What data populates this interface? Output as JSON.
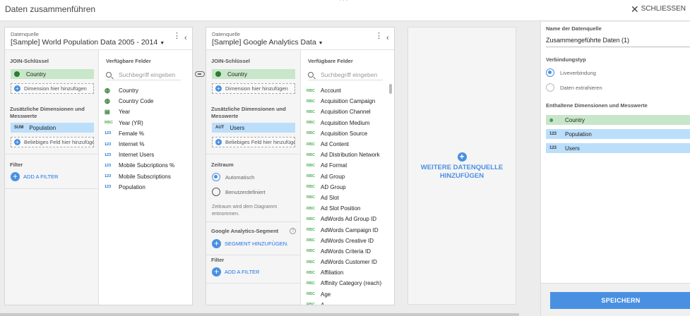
{
  "topbar": {
    "title": "Daten zusammenführen",
    "close_label": "SCHLIESSEN"
  },
  "panel1": {
    "source_label": "Datenquelle",
    "source_name": "[Sample] World Population Data 2005 - 2014",
    "join_keys_label": "JOIN-Schlüssel",
    "join_key": "Country",
    "add_dimension": "Dimension hier hinzufügen",
    "extra_label": "Zusätzliche Dimensionen und Messwerte",
    "metric_tag": "SUM",
    "metric": "Population",
    "add_field": "Beliebiges Feld hier hinzufügen",
    "filter_label": "Filter",
    "add_filter": "ADD A FILTER",
    "fields_header": "Verfügbare Felder",
    "search_placeholder": "Suchbegriff eingeben",
    "fields": [
      {
        "type": "geo",
        "name": "Country"
      },
      {
        "type": "geo",
        "name": "Country Code"
      },
      {
        "type": "cal",
        "name": "Year"
      },
      {
        "type": "txt",
        "name": "Year (YR)"
      },
      {
        "type": "num",
        "name": "Female %"
      },
      {
        "type": "num",
        "name": "Internet %"
      },
      {
        "type": "num",
        "name": "Internet Users"
      },
      {
        "type": "num",
        "name": "Mobile Subcriptions %"
      },
      {
        "type": "num",
        "name": "Mobile Subscriptions"
      },
      {
        "type": "num",
        "name": "Population"
      }
    ]
  },
  "panel2": {
    "source_label": "Datenquelle",
    "source_name": "[Sample] Google Analytics Data",
    "join_keys_label": "JOIN-Schlüssel",
    "join_key": "Country",
    "add_dimension": "Dimension hier hinzufügen",
    "extra_label": "Zusätzliche Dimensionen und Messwerte",
    "metric_tag": "AUT",
    "metric": "Users",
    "add_field": "Beliebiges Feld hier hinzufügen",
    "period_label": "Zeitraum",
    "period_auto": "Automatisch",
    "period_custom": "Benutzerdefiniert",
    "period_note": "Zeitraum wird dem Diagramm entnommen.",
    "segment_label": "Google Analytics-Segment",
    "add_segment": "SEGMENT HINZUFÜGEN.",
    "filter_label": "Filter",
    "add_filter": "ADD A FILTER",
    "fields_header": "Verfügbare Felder",
    "search_placeholder": "Suchbegriff eingeben",
    "fields": [
      {
        "type": "txt",
        "name": "Account"
      },
      {
        "type": "txt",
        "name": "Acquisition Campaign"
      },
      {
        "type": "txt",
        "name": "Acquisition Channel"
      },
      {
        "type": "txt",
        "name": "Acquisition Medium"
      },
      {
        "type": "txt",
        "name": "Acquisition Source"
      },
      {
        "type": "txt",
        "name": "Ad Content"
      },
      {
        "type": "txt",
        "name": "Ad Distribution Network"
      },
      {
        "type": "txt",
        "name": "Ad Format"
      },
      {
        "type": "txt",
        "name": "Ad Group"
      },
      {
        "type": "txt",
        "name": "AD Group"
      },
      {
        "type": "txt",
        "name": "Ad Slot"
      },
      {
        "type": "txt",
        "name": "Ad Slot Position"
      },
      {
        "type": "txt",
        "name": "AdWords Ad Group ID"
      },
      {
        "type": "txt",
        "name": "AdWords Campaign ID"
      },
      {
        "type": "txt",
        "name": "AdWords Creative ID"
      },
      {
        "type": "txt",
        "name": "AdWords Criteria ID"
      },
      {
        "type": "txt",
        "name": "AdWords Customer ID"
      },
      {
        "type": "txt",
        "name": "Affiliation"
      },
      {
        "type": "txt",
        "name": "Affinity Category (reach)"
      },
      {
        "type": "txt",
        "name": "Age"
      },
      {
        "type": "txt",
        "name": "A..."
      }
    ]
  },
  "add_source": {
    "line1": "WEITERE DATENQUELLE",
    "line2": "HINZUFÜGEN"
  },
  "sidebar": {
    "name_label": "Name der Datenquelle",
    "name_value": "Zusammengeführte Daten (1)",
    "conn_label": "Verbindungstyp",
    "conn_live": "Liveverbindung",
    "conn_extract": "Daten extrahieren",
    "contained_label": "Enthaltene Dimensionen und Messwerte",
    "items": [
      {
        "tag": "geo",
        "label": "Country",
        "color": "#c8e6c9"
      },
      {
        "tag": "123",
        "label": "Population",
        "color": "#bbdefb"
      },
      {
        "tag": "123",
        "label": "Users",
        "color": "#bbdefb"
      }
    ],
    "save_label": "SPEICHERN"
  },
  "colors": {
    "accent": "#4a90e2",
    "dimension": "#c8e6c9",
    "metric": "#bbdefb"
  }
}
